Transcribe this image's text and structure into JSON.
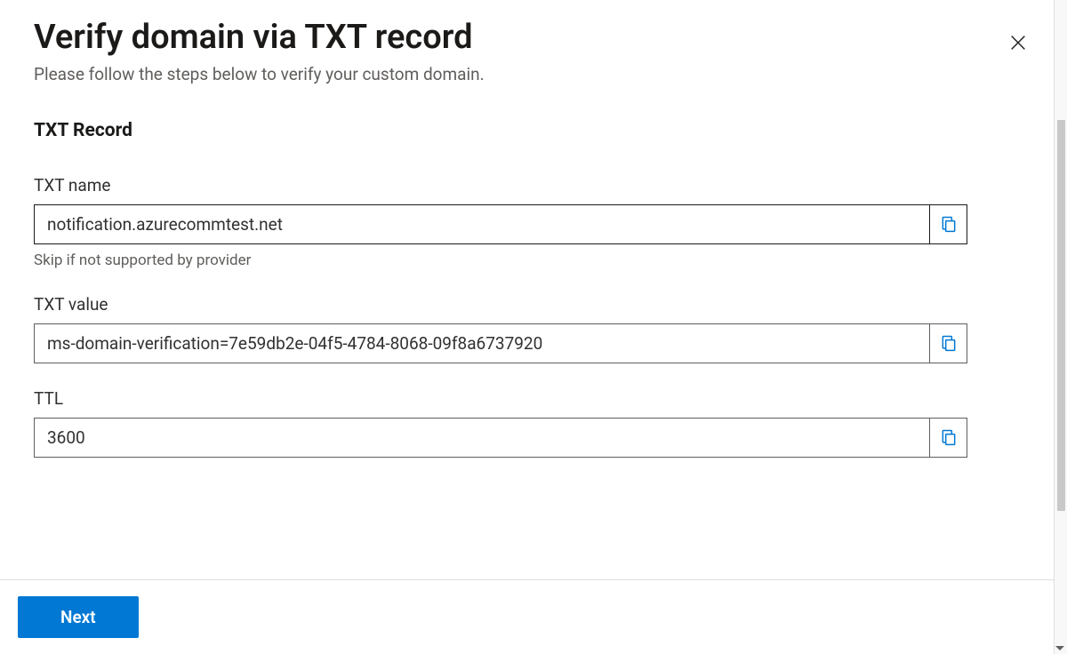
{
  "header": {
    "title": "Verify domain via TXT record",
    "subtitle": "Please follow the steps below to verify your custom domain."
  },
  "section": {
    "title": "TXT Record"
  },
  "fields": {
    "txt_name": {
      "label": "TXT name",
      "value": "notification.azurecommtest.net",
      "hint": "Skip if not supported by provider"
    },
    "txt_value": {
      "label": "TXT value",
      "value": "ms-domain-verification=7e59db2e-04f5-4784-8068-09f8a6737920"
    },
    "ttl": {
      "label": "TTL",
      "value": "3600"
    }
  },
  "footer": {
    "next_label": "Next"
  },
  "colors": {
    "primary": "#0078d4",
    "text": "#1b1a19",
    "muted": "#605e5c",
    "border": "#605e5c"
  }
}
